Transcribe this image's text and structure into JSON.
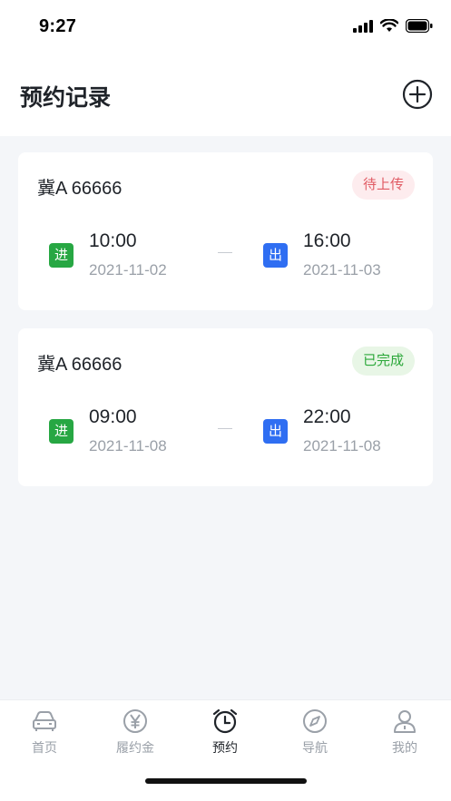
{
  "status_bar": {
    "time": "9:27"
  },
  "header": {
    "title": "预约记录",
    "add_icon": "plus-circle-icon"
  },
  "records": [
    {
      "plate": "冀A 66666",
      "status": "待上传",
      "status_color": "#e15b64",
      "in": {
        "icon_text": "进",
        "time": "10:00",
        "date": "2021-11-02"
      },
      "out": {
        "icon_text": "出",
        "time": "16:00",
        "date": "2021-11-03"
      }
    },
    {
      "plate": "冀A 66666",
      "status": "已完成",
      "status_color": "#2ca83a",
      "in": {
        "icon_text": "进",
        "time": "09:00",
        "date": "2021-11-08"
      },
      "out": {
        "icon_text": "出",
        "time": "22:00",
        "date": "2021-11-08"
      }
    }
  ],
  "tabbar": {
    "items": [
      {
        "label": "首页",
        "icon": "car-icon"
      },
      {
        "label": "履约金",
        "icon": "yen-icon"
      },
      {
        "label": "预约",
        "icon": "alarm-clock-icon",
        "active": true
      },
      {
        "label": "导航",
        "icon": "compass-icon"
      },
      {
        "label": "我的",
        "icon": "user-icon"
      }
    ]
  },
  "colors": {
    "accent_green": "#27a743",
    "accent_blue": "#2f6ef2"
  }
}
